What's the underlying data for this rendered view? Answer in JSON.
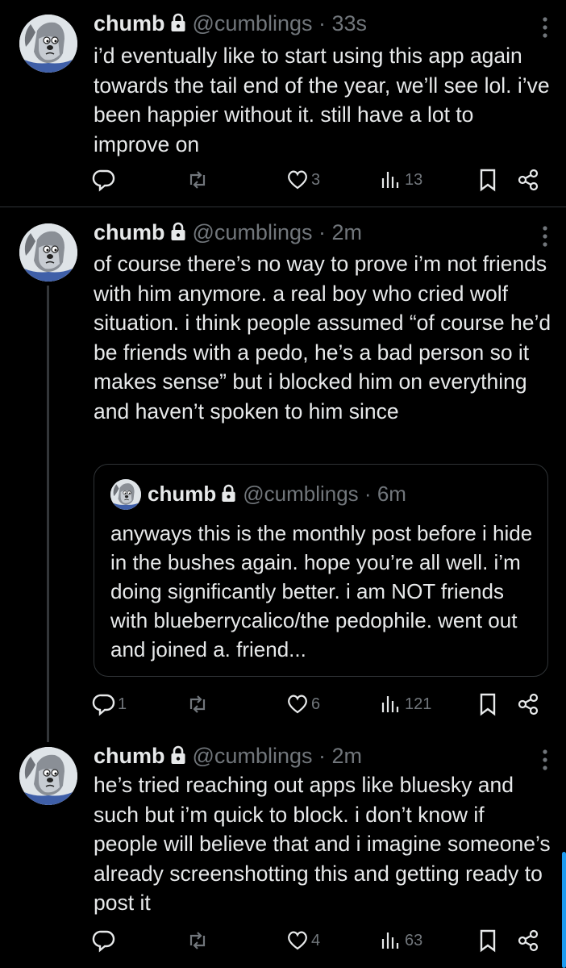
{
  "posts": [
    {
      "name": "chumb",
      "handle": "@cumblings",
      "dot": "·",
      "time": "33s",
      "text": "i’d eventually like to start using this app again towards the tail end of the year, we’ll see lol. i’ve been happier without it. still have a lot to improve on",
      "replies": "",
      "reposts": "",
      "likes": "3",
      "views": "13"
    },
    {
      "name": "chumb",
      "handle": "@cumblings",
      "dot": "·",
      "time": "2m",
      "text": "of course there’s no way to prove i’m not friends with him anymore. a real boy who cried wolf situation. i think people assumed “of course he’d be friends with a pedo, he’s a bad person so it makes sense” but i blocked him on everything and haven’t spoken to him since",
      "quote": {
        "name": "chumb",
        "handle": "@cumblings",
        "dot": "·",
        "time": "6m",
        "text": "anyways this is the monthly post before i hide in the bushes again. hope you’re all well. i’m doing significantly better. i am NOT friends with blueberrycalico/the pedophile. went out and joined a. friend..."
      },
      "replies": "1",
      "reposts": "",
      "likes": "6",
      "views": "121"
    },
    {
      "name": "chumb",
      "handle": "@cumblings",
      "dot": "·",
      "time": "2m",
      "text": "he’s tried reaching out apps like bluesky and such but i’m quick to block. i don’t know if people will believe that and i imagine someone’s already screenshotting this and getting ready to post it",
      "replies": "",
      "reposts": "",
      "likes": "4",
      "views": "63"
    }
  ],
  "icons": {
    "reply": "reply-icon",
    "repost": "repost-icon",
    "like": "heart-icon",
    "views": "views-icon",
    "bookmark": "bookmark-icon",
    "share": "share-icon",
    "lock": "lock-icon",
    "more": "more-icon"
  },
  "colors": {
    "background": "#000000",
    "text": "#e7e9ea",
    "muted": "#71767b",
    "border": "#2f3336",
    "accent": "#1d9bf0"
  }
}
